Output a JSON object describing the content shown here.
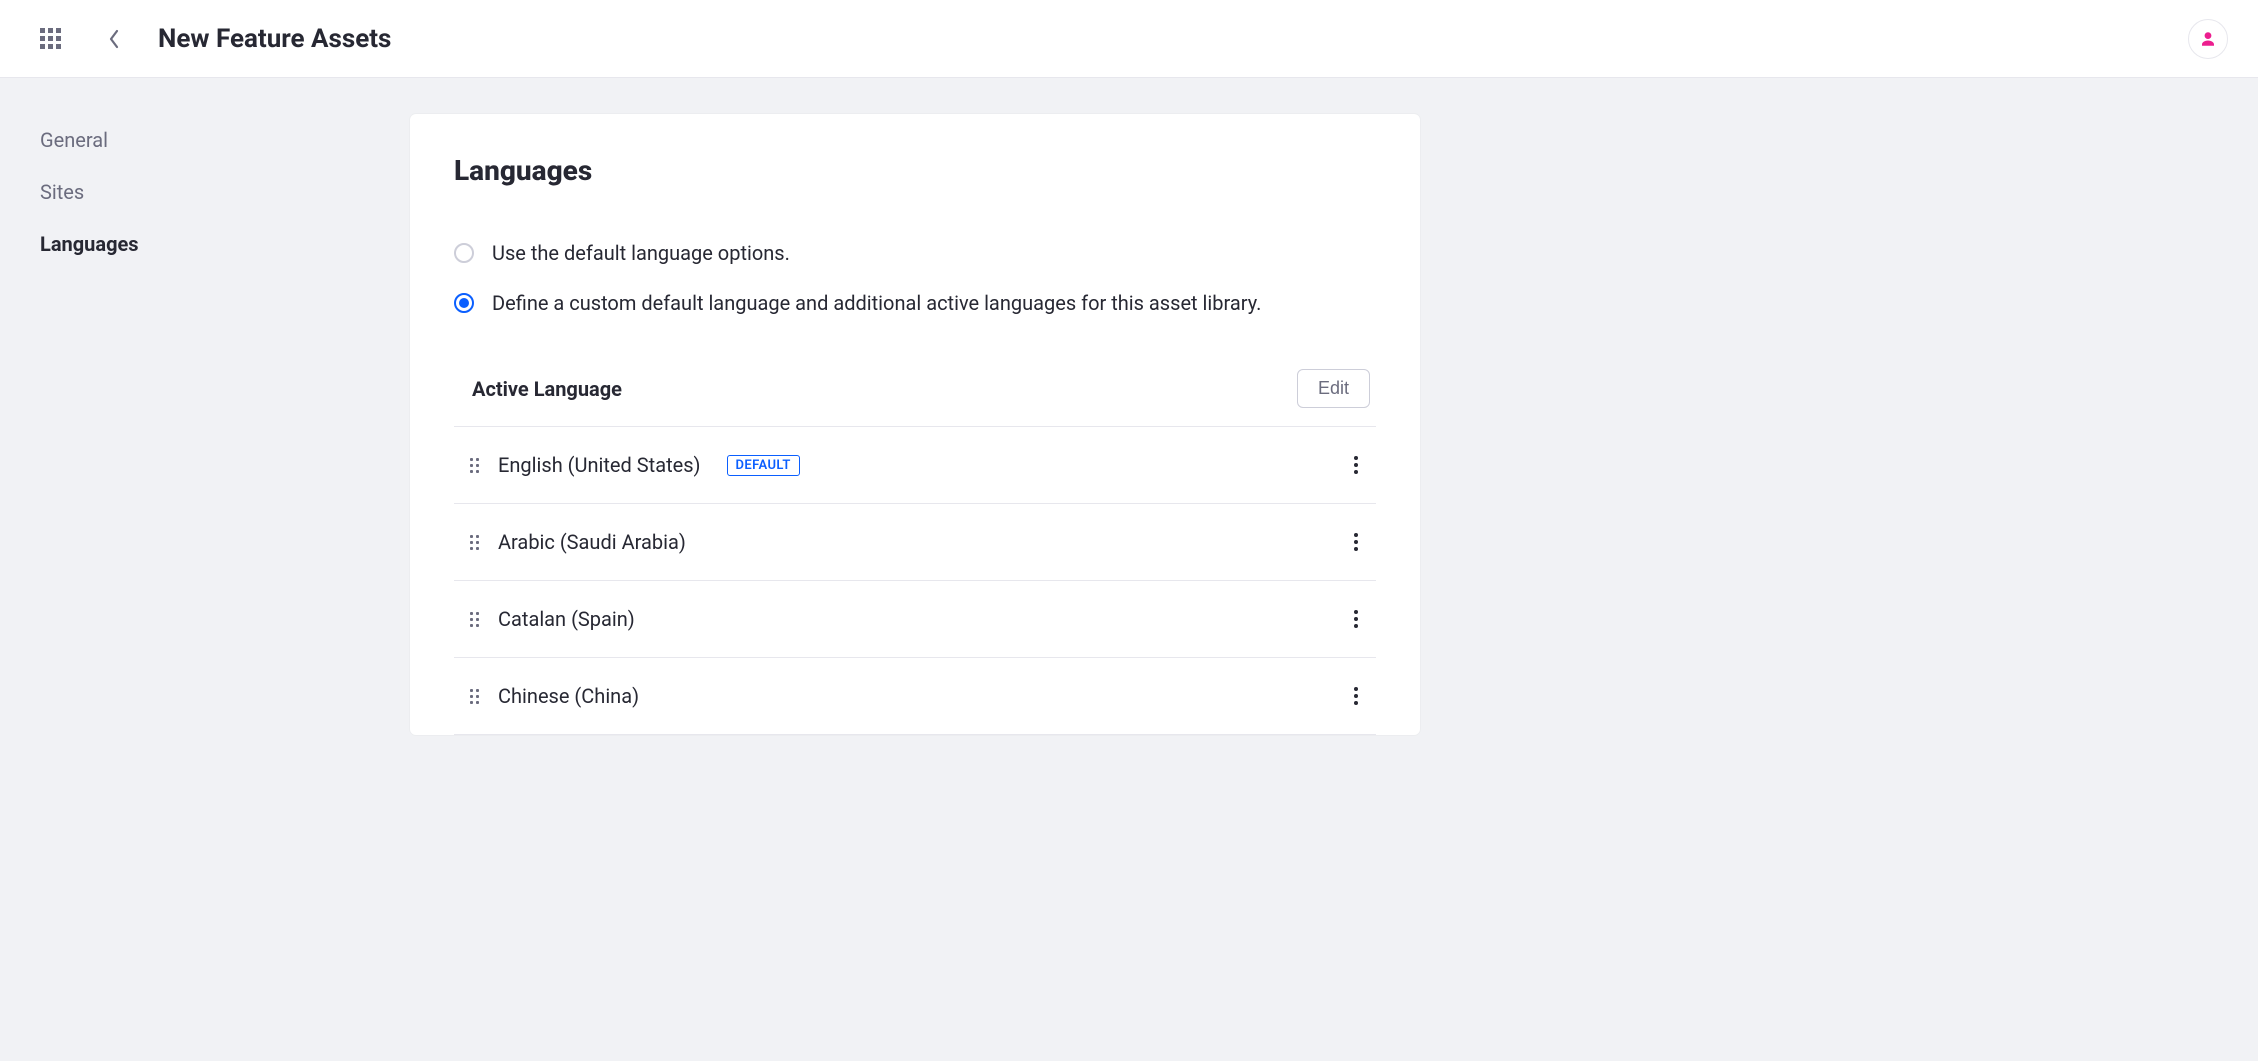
{
  "header": {
    "title": "New Feature Assets"
  },
  "sidebar": {
    "items": [
      {
        "label": "General",
        "active": false
      },
      {
        "label": "Sites",
        "active": false
      },
      {
        "label": "Languages",
        "active": true
      }
    ]
  },
  "main": {
    "heading": "Languages",
    "radios": {
      "default": "Use the default language options.",
      "custom": "Define a custom default language and additional active languages for this asset library.",
      "selected": "custom"
    },
    "active_section": {
      "title": "Active Language",
      "edit_label": "Edit",
      "default_badge": "DEFAULT",
      "languages": [
        {
          "name": "English (United States)",
          "default": true
        },
        {
          "name": "Arabic (Saudi Arabia)",
          "default": false
        },
        {
          "name": "Catalan (Spain)",
          "default": false
        },
        {
          "name": "Chinese (China)",
          "default": false
        }
      ]
    }
  }
}
